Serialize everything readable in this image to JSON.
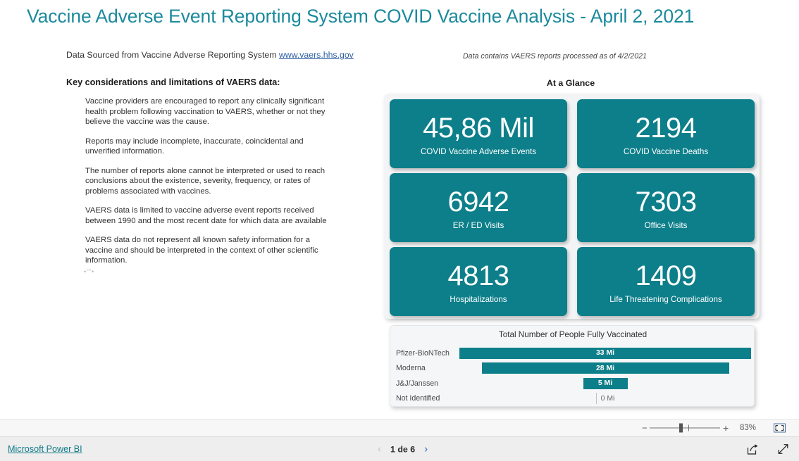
{
  "report": {
    "title": "Vaccine Adverse Event Reporting System COVID Vaccine Analysis -  April 2, 2021",
    "source_prefix": "Data Sourced from Vaccine Adverse Reporting System ",
    "source_link": "www.vaers.hhs.gov",
    "processed_note": "Data contains VAERS reports processed as of 4/2/2021",
    "accent_color": "#0d7f8a",
    "title_color": "#1b8a9d"
  },
  "considerations": {
    "heading": "Key considerations and limitations of VAERS data:",
    "paragraphs": [
      "Vaccine providers are encouraged to report any clinically significant health problem following vaccination to VAERS, whether or not they believe the vaccine was the cause.",
      "Reports may include incomplete, inaccurate, coincidental and unverified information.",
      "The number of reports alone cannot be interpreted or used to reach conclusions about the existence, severity, frequency, or rates of problems associated with vaccines.",
      "VAERS data is limited to vaccine adverse event reports received between 1990 and the most recent date for which data are available",
      "VAERS data do not represent all known safety information for a vaccine and should be interpreted in the context of other scientific information."
    ],
    "artifact": "•\"\"•"
  },
  "glance": {
    "heading": "At a Glance",
    "cards": [
      {
        "value": "45,86 Mil",
        "label": "COVID Vaccine Adverse Events"
      },
      {
        "value": "2194",
        "label": "COVID Vaccine Deaths"
      },
      {
        "value": "6942",
        "label": "ER / ED Visits"
      },
      {
        "value": "7303",
        "label": "Office Visits"
      },
      {
        "value": "4813",
        "label": "Hospitalizations"
      },
      {
        "value": "1409",
        "label": "Life Threatening Complications"
      }
    ]
  },
  "chart_data": {
    "type": "bar",
    "orientation": "horizontal",
    "title": "Total Number of People Fully Vaccinated",
    "xlabel": "",
    "ylabel": "",
    "unit": "Mi",
    "grid": false,
    "legend": "none",
    "categories": [
      "Pfizer-BioNTech",
      "Moderna",
      "J&J/Janssen",
      "Not Identified"
    ],
    "values": [
      33,
      28,
      5,
      0
    ],
    "labels": [
      "33 Mi",
      "28 Mi",
      "5 Mi",
      "0 Mi"
    ],
    "xlim": [
      0,
      33
    ],
    "bar_color": "#0d7f8a"
  },
  "zoombar": {
    "minus_label": "−",
    "plus_label": "+",
    "percent": "83%",
    "fit_icon": "fit-to-page-icon"
  },
  "footer": {
    "brand": "Microsoft Power BI",
    "prev_icon": "chevron-left-icon",
    "next_icon": "chevron-right-icon",
    "page_label": "1 de 6",
    "share_icon": "share-icon",
    "fullscreen_icon": "fullscreen-icon"
  }
}
